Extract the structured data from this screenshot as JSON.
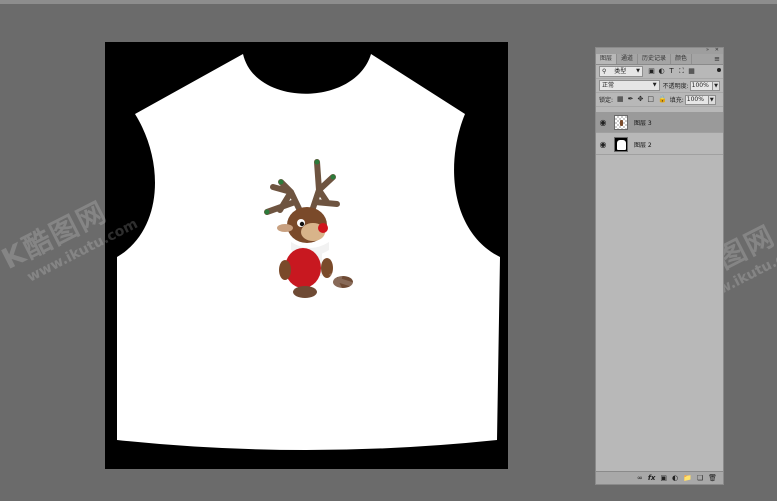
{
  "watermark": {
    "logo": "K酷图网",
    "url": "www.ikutu.com"
  },
  "layers_panel": {
    "tabs": [
      {
        "label": "图层",
        "active": true
      },
      {
        "label": "通道",
        "active": false
      },
      {
        "label": "历史记录",
        "active": false
      },
      {
        "label": "颜色",
        "active": false
      }
    ],
    "filter": {
      "value": "类型"
    },
    "blend_mode": {
      "value": "正常"
    },
    "opacity": {
      "label": "不透明度:",
      "value": "100%"
    },
    "lock": {
      "label": "锁定:"
    },
    "fill": {
      "label": "填充:",
      "value": "100%"
    },
    "layers": [
      {
        "name": "图层 3",
        "selected": true
      },
      {
        "name": "图层 2",
        "selected": false
      }
    ]
  },
  "colors": {
    "workspace_bg": "#6b6b6b",
    "panel_bg": "#b8b8b8",
    "selected_layer": "#9a9a9a"
  }
}
